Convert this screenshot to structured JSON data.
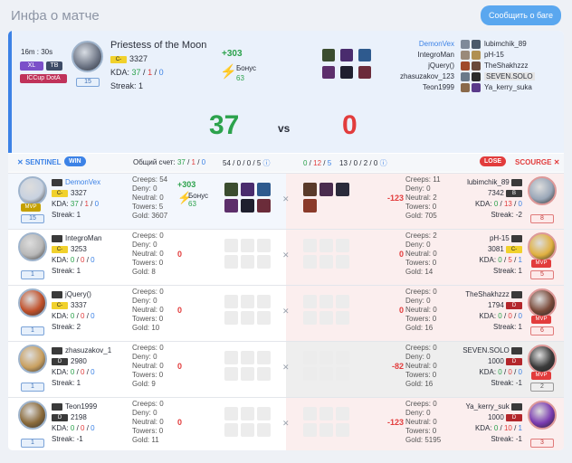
{
  "page": {
    "title": "Инфа о матче",
    "report_button": "Сообщить о баге"
  },
  "summary": {
    "time": "16m : 30s",
    "badges": [
      "XL",
      "TB"
    ],
    "league": "ICCup DotA",
    "hero": "Priestess of the Moon",
    "rank_badge": "C-",
    "rating": "3327",
    "kda_k": "37",
    "kda_d": "1",
    "kda_a": "0",
    "kda_label": "KDA:",
    "streak": "Streak: 1",
    "level": "15",
    "points": "+303",
    "bonus_label": "Бонус",
    "bonus": "63",
    "score_left": "37",
    "score_vs": "vs",
    "score_right": "0",
    "left_players": [
      "DemonVex",
      "IntegroMan",
      "jQuery()",
      "zhasuzakov_123",
      "Teon1999"
    ],
    "right_players": [
      "lubimchik_89",
      "pH-15",
      "TheShakhzzz",
      "SEVEN.SOLO",
      "Ya_kerry_suka"
    ]
  },
  "teams": {
    "left_label": "SENTINEL",
    "left_result": "WIN",
    "overall_label": "Общий счет:",
    "overall_k": "37",
    "overall_d": "1",
    "overall_a": "0",
    "score_mid1": "54",
    "score_mid2": "0",
    "score_mid3": "0",
    "score_mid4": "5",
    "right_1": "0",
    "right_2": "12",
    "right_3": "5",
    "right_4": "13",
    "right_5": "0",
    "right_6": "2",
    "right_7": "0",
    "right_result": "LOSE",
    "right_label": "SCOURGE"
  },
  "rows": [
    {
      "l_name": "DemonVex",
      "l_rank": "C-",
      "l_rating": "3327",
      "l_k": "37",
      "l_d": "1",
      "l_a": "0",
      "l_streak": "Streak: 1",
      "l_level": "15",
      "l_mvp": "MVP",
      "l_creeps": "Creeps: 54",
      "l_deny": "Deny: 0",
      "l_neutral": "Neutral: 0",
      "l_towers": "Towers: 5",
      "l_gold": "Gold: 3607",
      "l_points": "+303",
      "l_bonus_label": "Бонус",
      "l_bonus": "63",
      "delta": "-123",
      "r_creeps": "Creeps: 11",
      "r_deny": "Deny: 0",
      "r_neutral": "Neutral: 2",
      "r_towers": "Towers: 0",
      "r_gold": "Gold: 705",
      "r_name": "lubimchik_89",
      "r_rank": "B",
      "r_rating": "7342",
      "r_k": "0",
      "r_d": "13",
      "r_a": "0",
      "r_streak": "Streak: -2",
      "r_level": "8"
    },
    {
      "l_name": "IntegroMan",
      "l_rank": "C-",
      "l_rating": "3253",
      "l_k": "0",
      "l_d": "0",
      "l_a": "0",
      "l_streak": "Streak: 1",
      "l_level": "1",
      "l_creeps": "Creeps: 0",
      "l_deny": "Deny: 0",
      "l_neutral": "Neutral: 0",
      "l_towers": "Towers: 0",
      "l_gold": "Gold: 8",
      "l_points": "0",
      "delta": "0",
      "r_creeps": "Creeps: 2",
      "r_deny": "Deny: 0",
      "r_neutral": "Neutral: 0",
      "r_towers": "Towers: 0",
      "r_gold": "Gold: 14",
      "r_name": "pH-15",
      "r_rank": "C-",
      "r_rating": "3081",
      "r_k": "0",
      "r_d": "5",
      "r_a": "1",
      "r_streak": "Streak: 1",
      "r_level": "5",
      "r_mvp": "MVP"
    },
    {
      "l_name": "jQuery()",
      "l_rank": "C-",
      "l_rating": "3337",
      "l_k": "0",
      "l_d": "0",
      "l_a": "0",
      "l_streak": "Streak: 2",
      "l_level": "1",
      "l_creeps": "Creeps: 0",
      "l_deny": "Deny: 0",
      "l_neutral": "Neutral: 0",
      "l_towers": "Towers: 0",
      "l_gold": "Gold: 10",
      "l_points": "0",
      "delta": "0",
      "r_creeps": "Creeps: 0",
      "r_deny": "Deny: 0",
      "r_neutral": "Neutral: 0",
      "r_towers": "Towers: 0",
      "r_gold": "Gold: 16",
      "r_name": "TheShakhzzz",
      "r_rank": "D",
      "r_rating": "1794",
      "r_k": "0",
      "r_d": "0",
      "r_a": "0",
      "r_streak": "Streak: 1",
      "r_level": "6",
      "r_mvp": "MVP"
    },
    {
      "l_name": "zhasuzakov_1",
      "l_rank": "D",
      "l_rating": "2980",
      "l_k": "0",
      "l_d": "0",
      "l_a": "0",
      "l_streak": "Streak: 1",
      "l_level": "1",
      "l_creeps": "Creeps: 0",
      "l_deny": "Deny: 0",
      "l_neutral": "Neutral: 0",
      "l_towers": "Towers: 0",
      "l_gold": "Gold: 9",
      "l_points": "0",
      "delta": "-82",
      "r_creeps": "Creeps: 0",
      "r_deny": "Deny: 0",
      "r_neutral": "Neutral: 0",
      "r_towers": "Towers: 0",
      "r_gold": "Gold: 16",
      "r_name": "SEVEN.SOLO",
      "r_rank": "D",
      "r_rating": "1000",
      "r_k": "0",
      "r_d": "0",
      "r_a": "0",
      "r_streak": "Streak: -1",
      "r_level": "2",
      "r_mvp": "MVP"
    },
    {
      "l_name": "Teon1999",
      "l_rank": "D",
      "l_rating": "2198",
      "l_k": "0",
      "l_d": "0",
      "l_a": "0",
      "l_streak": "Streak: -1",
      "l_level": "1",
      "l_creeps": "Creeps: 0",
      "l_deny": "Deny: 0",
      "l_neutral": "Neutral: 0",
      "l_towers": "Towers: 0",
      "l_gold": "Gold: 11",
      "l_points": "0",
      "delta": "-123",
      "r_creeps": "Creeps: 0",
      "r_deny": "Deny: 0",
      "r_neutral": "Neutral: 0",
      "r_towers": "Towers: 0",
      "r_gold": "Gold: 5195",
      "r_name": "Ya_kerry_suk",
      "r_rank": "D",
      "r_rating": "1000",
      "r_k": "0",
      "r_d": "10",
      "r_a": "1",
      "r_streak": "Streak: -1",
      "r_level": "3"
    }
  ],
  "colors": {
    "accent": "#3c82e6",
    "win": "#2ca24c",
    "lose": "#e23c3c",
    "header_bg": "#eaf1fb"
  }
}
